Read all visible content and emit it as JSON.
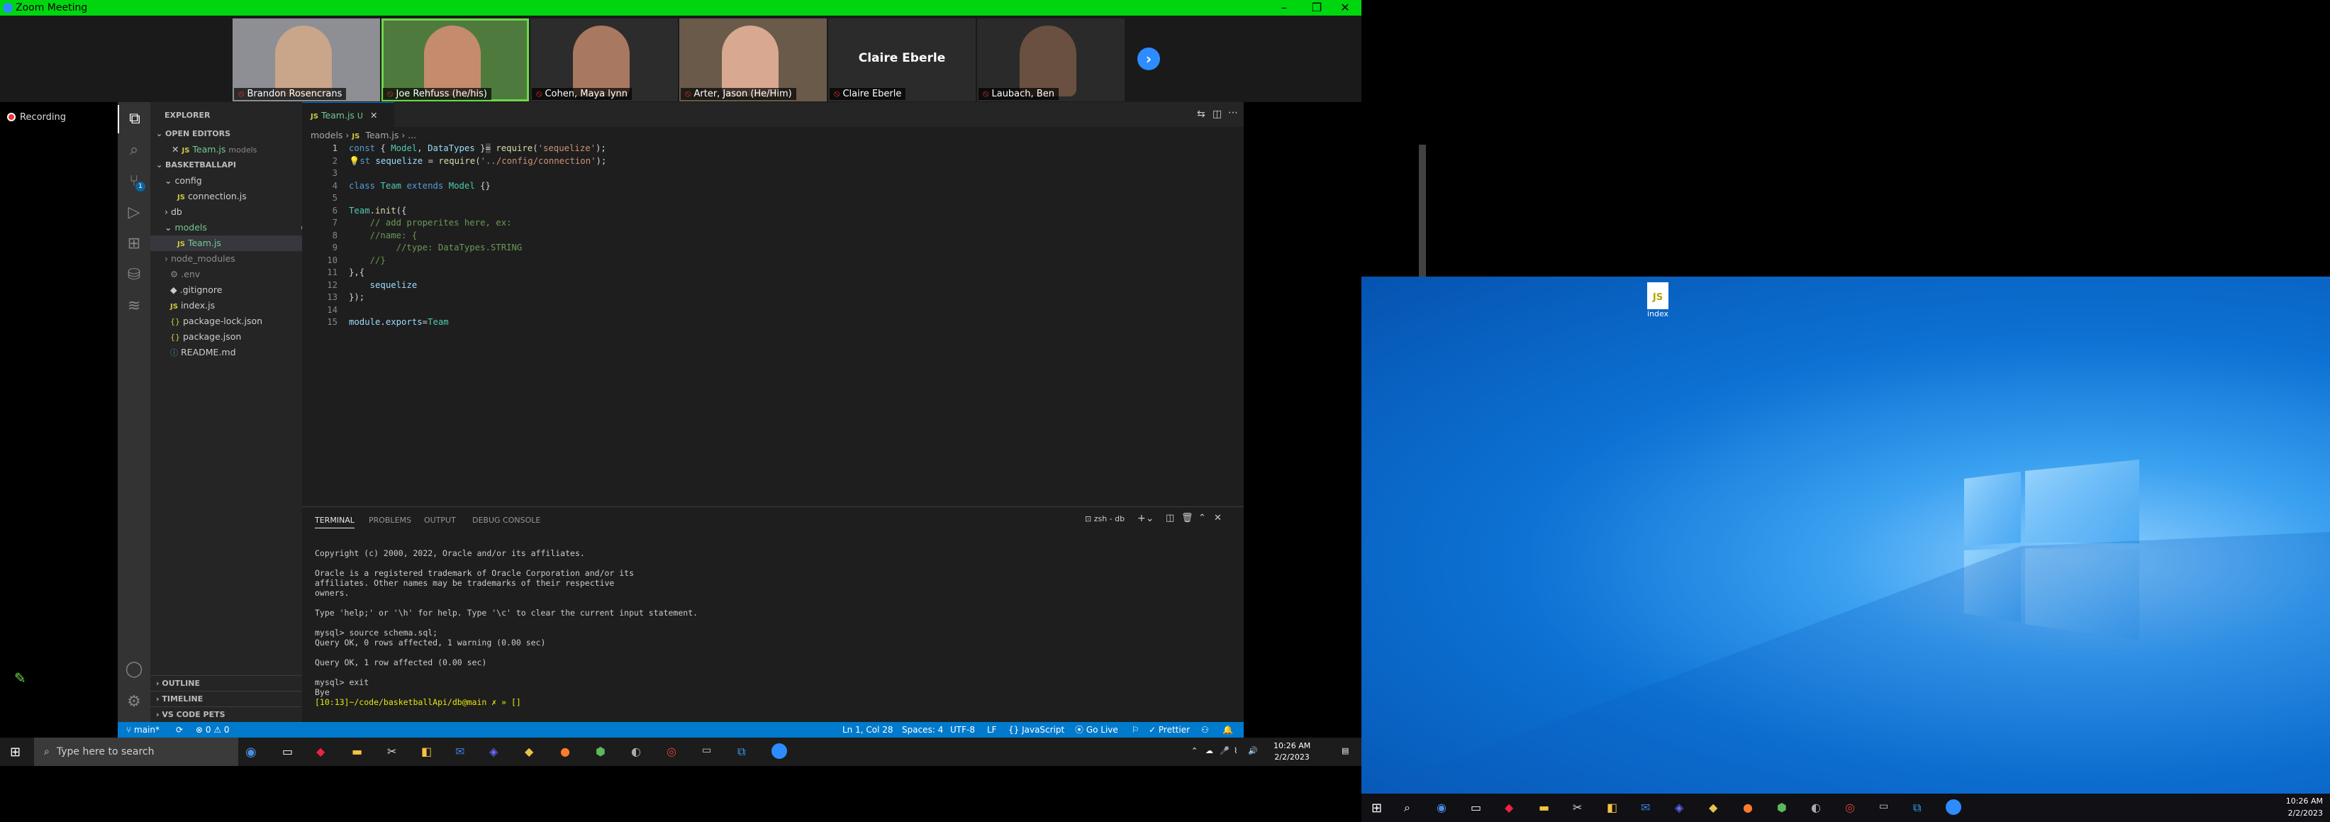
{
  "zoom": {
    "title": "Zoom Meeting",
    "recording": "Recording",
    "participants": [
      {
        "name": "Brandon Rosencrans",
        "muted": true,
        "video": true,
        "face": "#c9a58a",
        "bg": "#8d8f95"
      },
      {
        "name": "Joe Rehfuss (he/his)",
        "muted": true,
        "video": true,
        "face": "#c48c6c",
        "bg": "#4f7a3d",
        "speaking": true
      },
      {
        "name": "Cohen, Maya lynn",
        "muted": true,
        "video": true,
        "face": "#a87860",
        "bg": "#2c2c2c"
      },
      {
        "name": "Arter, Jason (He/Him)",
        "muted": true,
        "video": true,
        "face": "#d8a890",
        "bg": "#6a5a4a"
      },
      {
        "name": "Claire Eberle",
        "muted": true,
        "video": false
      },
      {
        "name": "Laubach, Ben",
        "muted": true,
        "video": true,
        "face": "#6a5040",
        "bg": "#2a2a2a"
      }
    ],
    "next_icon": "›"
  },
  "vscode": {
    "explorer_title": "EXPLORER",
    "open_editors": "OPEN EDITORS",
    "open_file": "Team.js",
    "open_file_dir": "models",
    "project": "BASKETBALLAPI",
    "tree": {
      "config": "config",
      "connection": "connection.js",
      "db": "db",
      "models": "models",
      "team": "Team.js",
      "node_modules": "node_modules",
      "env": ".env",
      "gitignore": ".gitignore",
      "index": "index.js",
      "pkglock": "package-lock.json",
      "pkg": "package.json",
      "readme": "README.md"
    },
    "git_status": "U",
    "outline": "OUTLINE",
    "timeline": "TIMELINE",
    "code_pets": "VS CODE PETS",
    "tab_label": "Team.js",
    "tab_status": "U",
    "breadcrumb": [
      "models",
      "Team.js",
      "..."
    ],
    "code_lines": [
      "1",
      "2",
      "3",
      "4",
      "5",
      "6",
      "7",
      "8",
      "9",
      "10",
      "11",
      "12",
      "13",
      "14",
      "15"
    ],
    "panel_tabs": [
      "TERMINAL",
      "PROBLEMS",
      "OUTPUT",
      "DEBUG CONSOLE"
    ],
    "terminal_name": "zsh - db",
    "terminal_lines": [
      "Copyright (c) 2000, 2022, Oracle and/or its affiliates.",
      "",
      "Oracle is a registered trademark of Oracle Corporation and/or its",
      "affiliates. Other names may be trademarks of their respective",
      "owners.",
      "",
      "Type 'help;' or '\\h' for help. Type '\\c' to clear the current input statement.",
      "",
      "mysql> source schema.sql;",
      "Query OK, 0 rows affected, 1 warning (0.00 sec)",
      "",
      "Query OK, 1 row affected (0.00 sec)",
      "",
      "mysql> exit",
      "Bye",
      "[10:13]~/code/basketballApi/db@main ✗ » []"
    ],
    "status": {
      "branch": "main*",
      "sync": "⟳",
      "problems": "⊗ 0 ⚠ 0",
      "position": "Ln 1, Col 28",
      "spaces": "Spaces: 4",
      "encoding": "UTF-8",
      "eol": "LF",
      "language": "{} JavaScript",
      "golive": "⦿ Go Live",
      "prettier": "✓ Prettier"
    }
  },
  "taskbar_left": {
    "search_placeholder": "Type here to search",
    "time": "10:26 AM",
    "date": "2/2/2023"
  },
  "desktop": {
    "file_label": "index",
    "file_icon": "JS",
    "time": "10:26 AM",
    "date": "2/2/2023"
  }
}
